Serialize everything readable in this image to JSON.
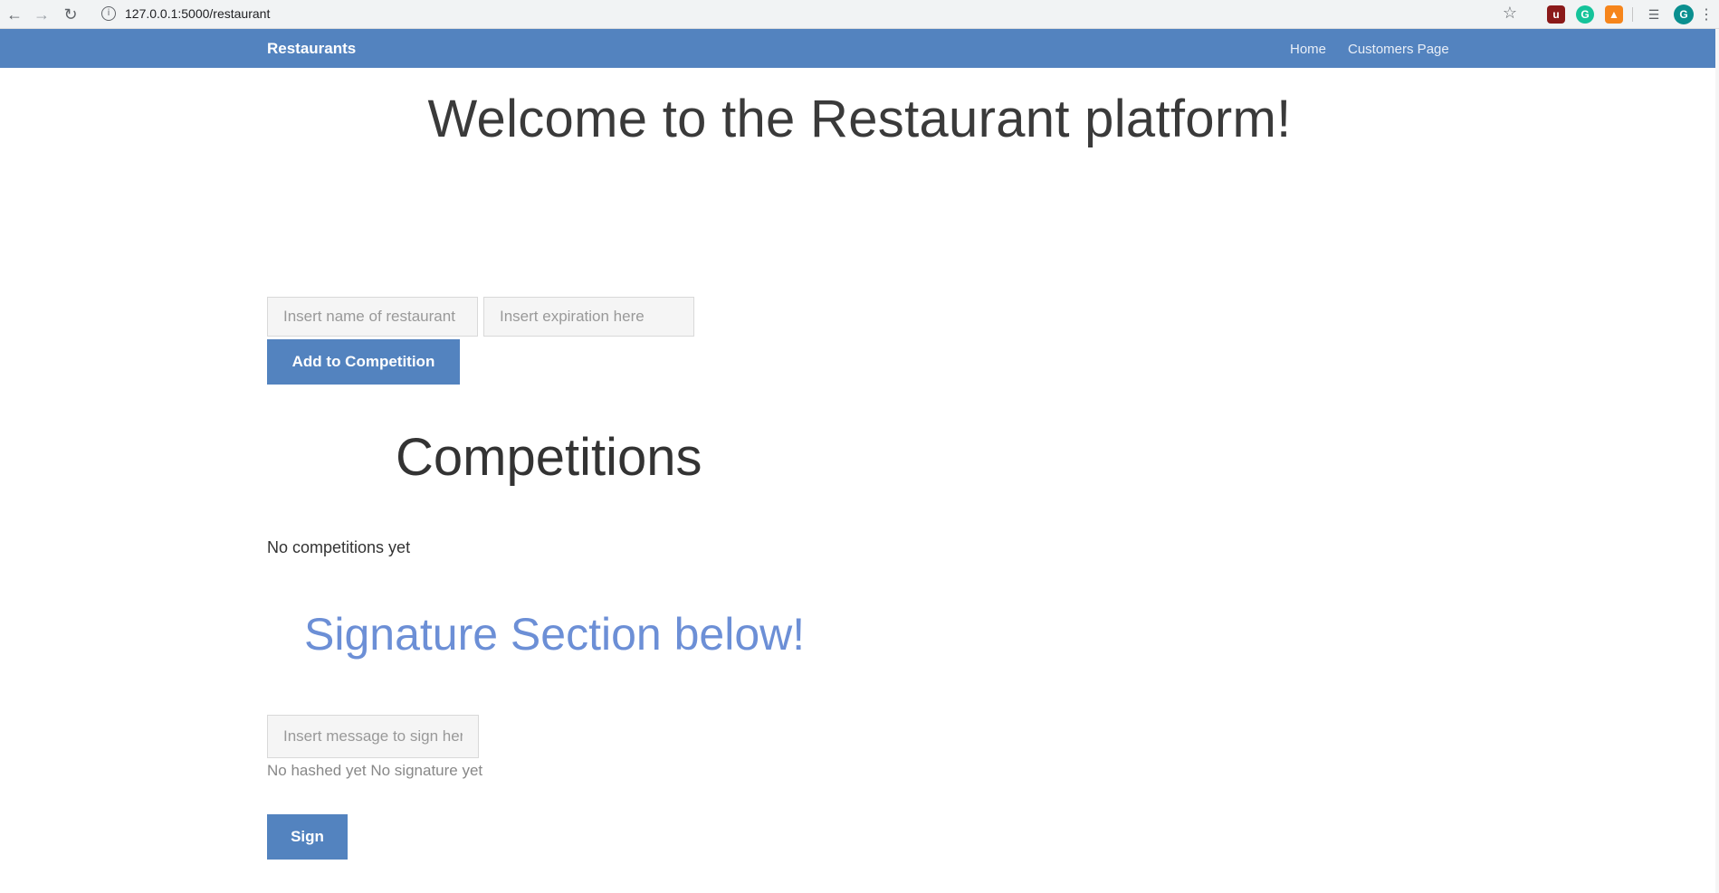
{
  "browser": {
    "url": "127.0.0.1:5000/restaurant",
    "back_icon": "arrow-left-icon",
    "forward_icon": "arrow-right-icon",
    "reload_icon": "reload-icon",
    "profile_initial": "G"
  },
  "navbar": {
    "brand": "Restaurants",
    "links": [
      "Home",
      "Customers Page"
    ],
    "color": "#5383bf"
  },
  "main": {
    "welcome_title": "Welcome to the Restaurant platform!",
    "competition_form": {
      "name_placeholder": "Insert name of restaurant",
      "expiration_placeholder": "Insert expiration here",
      "submit_label": "Add to Competition"
    },
    "competitions": {
      "title": "Competitions",
      "empty_text": "No competitions yet"
    },
    "signature": {
      "title": "Signature Section below!",
      "title_color": "#6c8fd6",
      "message_placeholder": "Insert message to sign here",
      "status_text": "No hashed yet No signature yet",
      "sign_label": "Sign"
    }
  }
}
